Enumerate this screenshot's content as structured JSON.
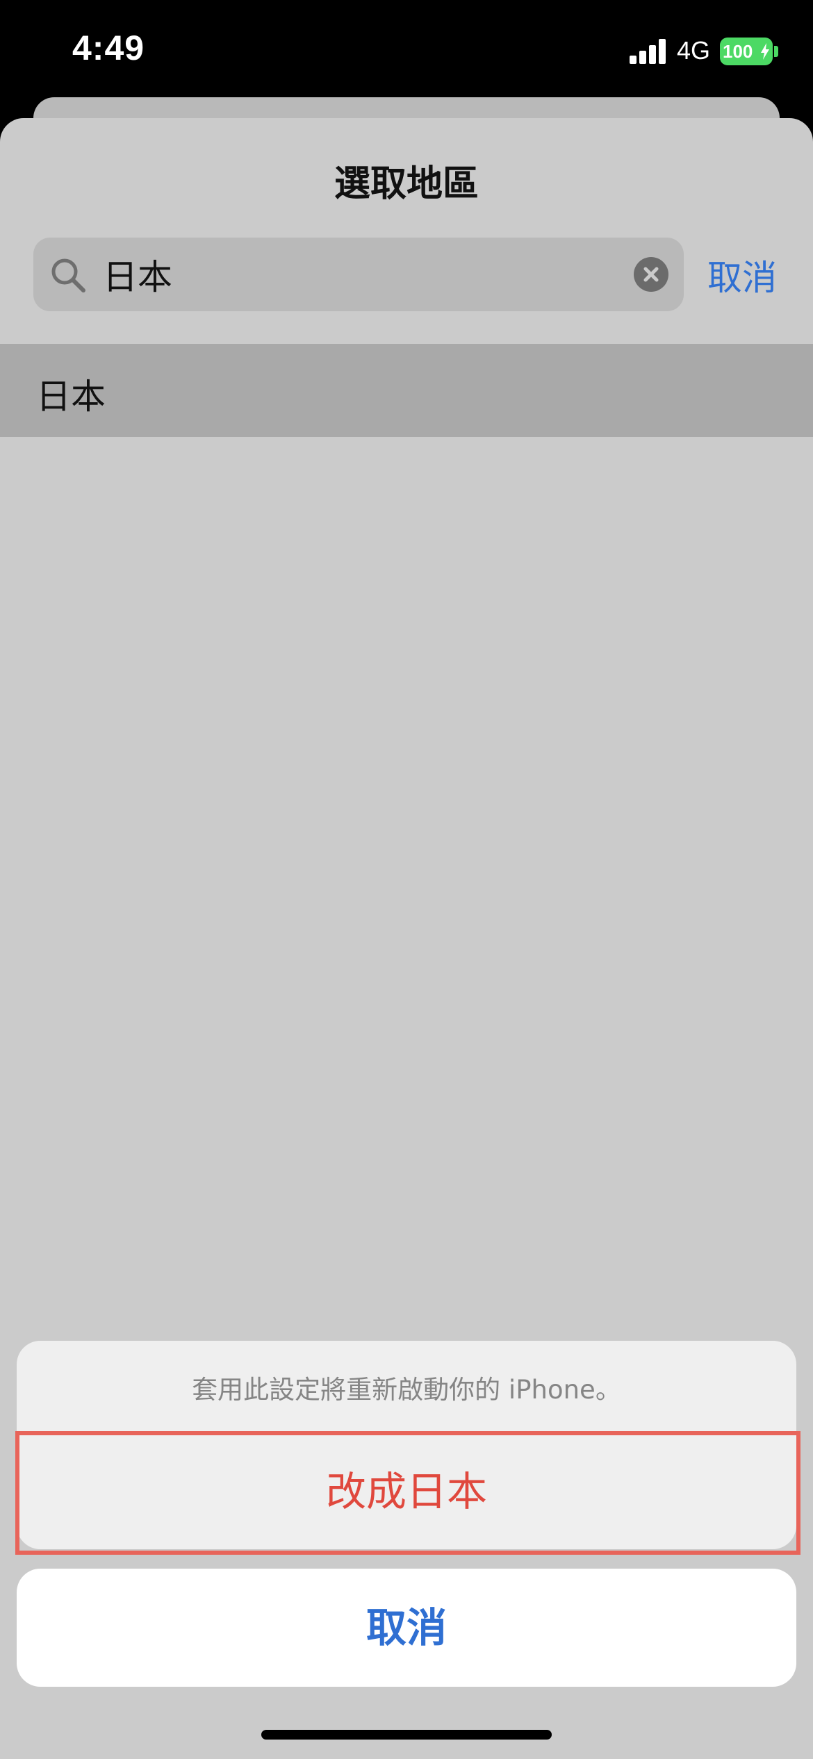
{
  "status_bar": {
    "time": "4:49",
    "network": "4G",
    "battery": "100",
    "battery_color": "#4cd964"
  },
  "sheet": {
    "title": "選取地區",
    "search": {
      "value": "日本",
      "icon": "search-icon",
      "clear_icon": "clear-icon"
    },
    "cancel_label": "取消",
    "results": [
      {
        "label": "日本"
      }
    ]
  },
  "action_sheet": {
    "message": "套用此設定將重新啟動你的 iPhone。",
    "destructive_label": "改成日本",
    "cancel_label": "取消"
  },
  "colors": {
    "accent": "#2f6fd2",
    "destructive": "#e0483d",
    "highlight": "#e8645a"
  }
}
